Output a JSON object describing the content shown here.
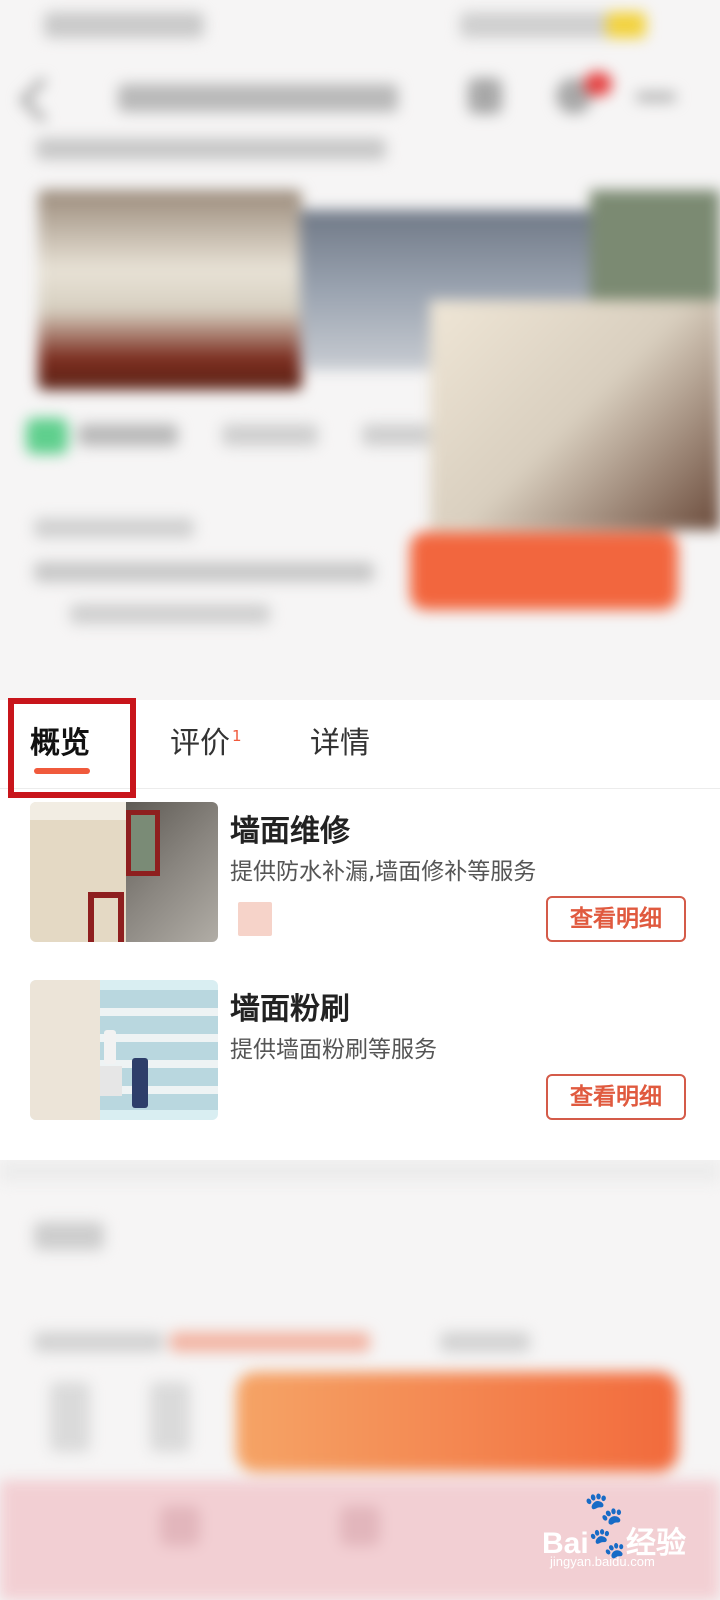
{
  "tabs": [
    {
      "label": "概览",
      "active": true
    },
    {
      "label": "评价",
      "badge": "1"
    },
    {
      "label": "详情"
    }
  ],
  "services": [
    {
      "title": "墙面维修",
      "description": "提供防水补漏,墙面修补等服务",
      "button": "查看明细",
      "image_icon": "wall-repair-photo"
    },
    {
      "title": "墙面粉刷",
      "description": "提供墙面粉刷等服务",
      "button": "查看明细",
      "image_icon": "wall-painting-photo"
    }
  ],
  "colors": {
    "accent": "#f05a3c",
    "highlight_box": "#c8151b"
  },
  "watermark": {
    "brand": "Bai",
    "brand_cn": "经验",
    "site": "jingyan.baidu.com"
  }
}
